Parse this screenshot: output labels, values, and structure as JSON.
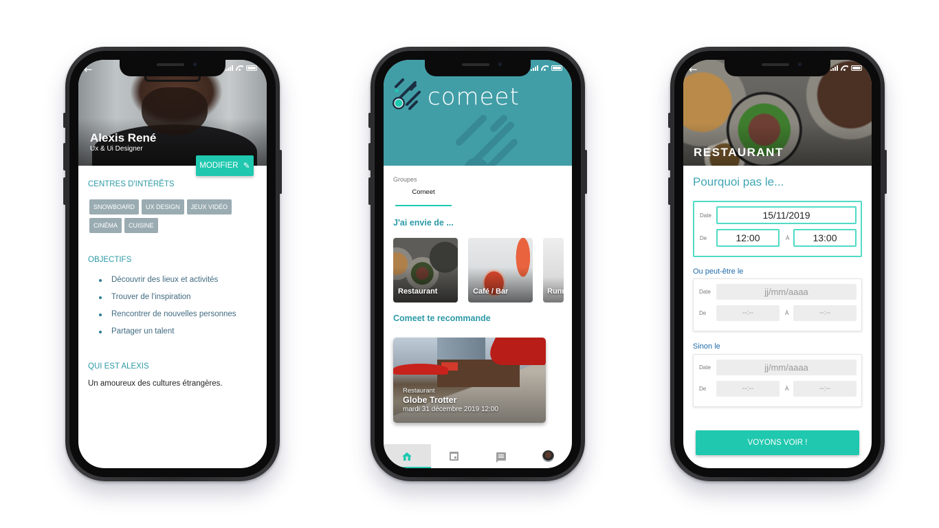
{
  "colors": {
    "accent": "#1fc8ae",
    "teal_heading": "#2d9aa7",
    "home_header": "#419ea7",
    "tag_bg": "#9aacb2"
  },
  "profile_screen": {
    "back_icon": "arrow-left-icon",
    "name": "Alexis René",
    "role": "Ux & Ui Designer",
    "edit_button": {
      "label": "MODIFIER",
      "icon": "pencil-icon"
    },
    "interests": {
      "title": "CENTRES D'INTÉRÊTS",
      "tags": [
        "SNOWBOARD",
        "UX DESIGN",
        "JEUX VIDÉO",
        "CINÉMA",
        "CUISINE"
      ]
    },
    "objectives": {
      "title": "OBJECTIFS",
      "items": [
        "Découvrir des lieux et activités",
        "Trouver de l'inspiration",
        "Rencontrer de nouvelles personnes",
        "Partager un talent"
      ]
    },
    "about": {
      "title": "QUI EST ALEXIS",
      "text": "Un amoureux des cultures étrangères."
    }
  },
  "home_screen": {
    "logo_text": "comeet",
    "groups_label": "Groupes",
    "group_tabs": [
      {
        "label": "Comeet",
        "selected": true
      }
    ],
    "want_title": "J'ai envie de ...",
    "categories": [
      {
        "label": "Restaurant"
      },
      {
        "label": "Café / Bar"
      },
      {
        "label": "Runn"
      }
    ],
    "recommend_title": "Comeet te recommande",
    "recommendation": {
      "category": "Restaurant",
      "name": "Globe Trotter",
      "datetime": "mardi 31 décembre 2019 12:00"
    },
    "bottom_nav": [
      {
        "icon": "home-icon",
        "active": true
      },
      {
        "icon": "calendar-icon",
        "active": false
      },
      {
        "icon": "chat-icon",
        "active": false
      },
      {
        "icon": "avatar-icon",
        "active": false
      }
    ]
  },
  "restaurant_screen": {
    "back_icon": "arrow-left-icon",
    "header_title": "RESTAURANT",
    "prompt": "Pourquoi pas le...",
    "labels": {
      "date": "Date",
      "from": "De",
      "to": "À"
    },
    "slot1": {
      "date": "15/11/2019",
      "from": "12:00",
      "to": "13:00"
    },
    "slot2": {
      "title": "Ou peut-être le",
      "date_placeholder": "jj/mm/aaaa",
      "from_placeholder": "--:--",
      "to_placeholder": "--:--"
    },
    "slot3": {
      "title": "Sinon le",
      "date_placeholder": "jj/mm/aaaa",
      "from_placeholder": "--:--",
      "to_placeholder": "--:--"
    },
    "submit_label": "VOYONS VOIR !"
  }
}
